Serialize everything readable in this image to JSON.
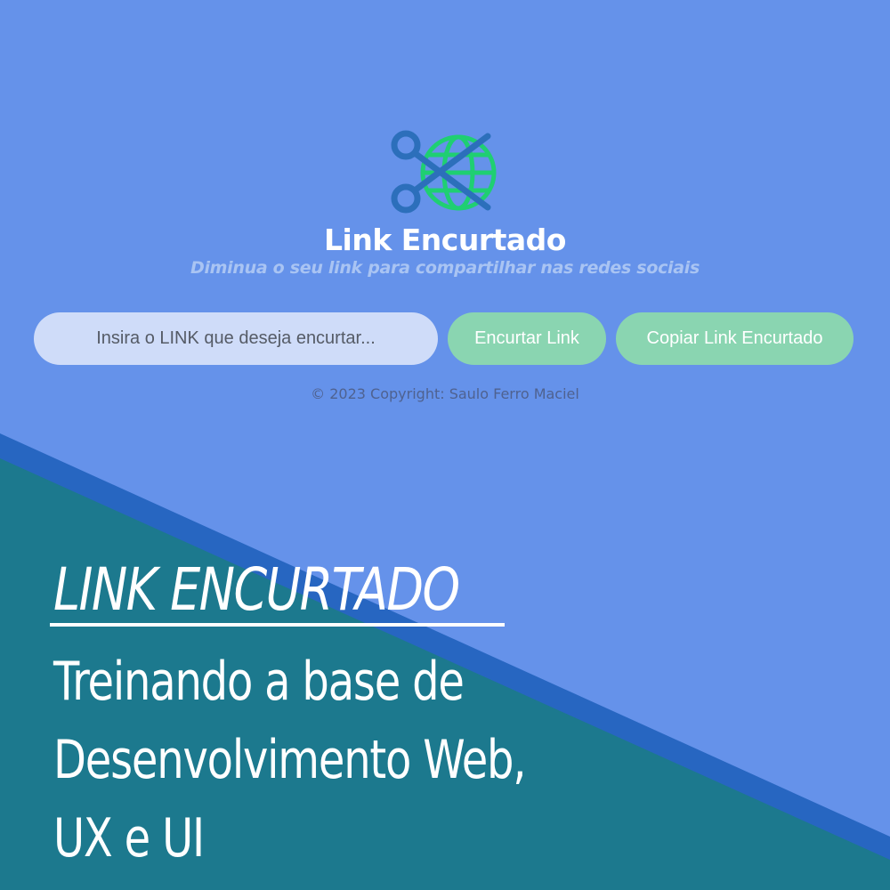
{
  "colors": {
    "background": "#6592ea",
    "diagonal_band": "#2766c1",
    "footer_panel": "#1c798e",
    "input_bg": "#cfdcf9",
    "button_bg": "#8ad5b1",
    "logo_scissors": "#2c6fbb",
    "logo_globe": "#1fcf72"
  },
  "app": {
    "logo_icon": "scissors-globe-icon",
    "title": "Link Encurtado",
    "subtitle": "Diminua o seu link para compartilhar nas redes sociais",
    "input_placeholder": "Insira o LINK que deseja encurtar...",
    "shorten_label": "Encurtar Link",
    "copy_label": "Copiar Link Encurtado",
    "copyright": "© 2023 Copyright: Saulo Ferro Maciel"
  },
  "promo": {
    "title": "LINK ENCURTADO",
    "lines": [
      "Treinando a base de",
      "Desenvolvimento Web,",
      "UX e UI"
    ]
  }
}
